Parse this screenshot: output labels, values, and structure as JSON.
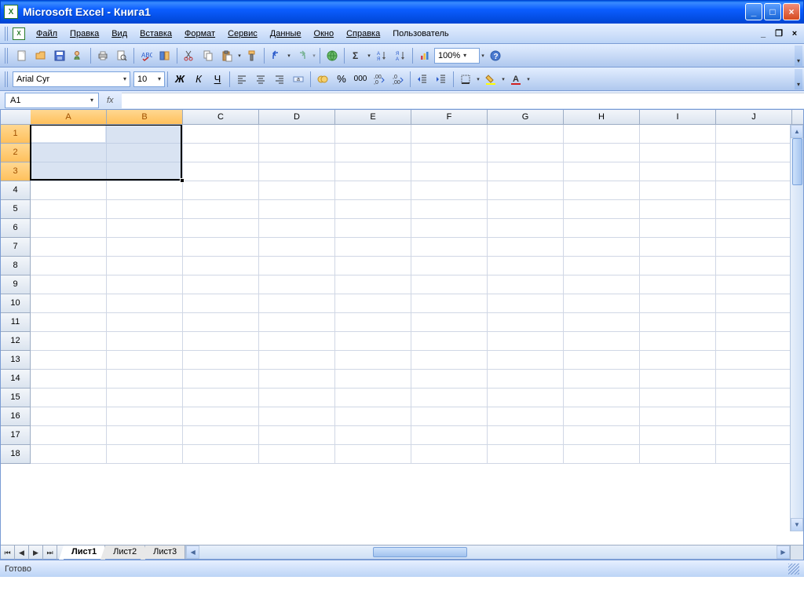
{
  "title": "Microsoft Excel - Книга1",
  "menu": [
    "Файл",
    "Правка",
    "Вид",
    "Вставка",
    "Формат",
    "Сервис",
    "Данные",
    "Окно",
    "Справка",
    "Пользователь"
  ],
  "font": {
    "name": "Arial Cyr",
    "size": "10"
  },
  "format_buttons": {
    "bold": "Ж",
    "italic": "К",
    "underline": "Ч"
  },
  "zoom": "100%",
  "percent_label": "%",
  "thousands_label": "000",
  "namebox": "A1",
  "fx": "fx",
  "columns": [
    "A",
    "B",
    "C",
    "D",
    "E",
    "F",
    "G",
    "H",
    "I",
    "J"
  ],
  "selected_cols": [
    "A",
    "B"
  ],
  "rows": [
    1,
    2,
    3,
    4,
    5,
    6,
    7,
    8,
    9,
    10,
    11,
    12,
    13,
    14,
    15,
    16,
    17,
    18
  ],
  "selected_rows": [
    1,
    2,
    3
  ],
  "selection": {
    "active": "A1",
    "range": "A1:B3"
  },
  "sheets": [
    "Лист1",
    "Лист2",
    "Лист3"
  ],
  "active_sheet": "Лист1",
  "status": "Готово"
}
